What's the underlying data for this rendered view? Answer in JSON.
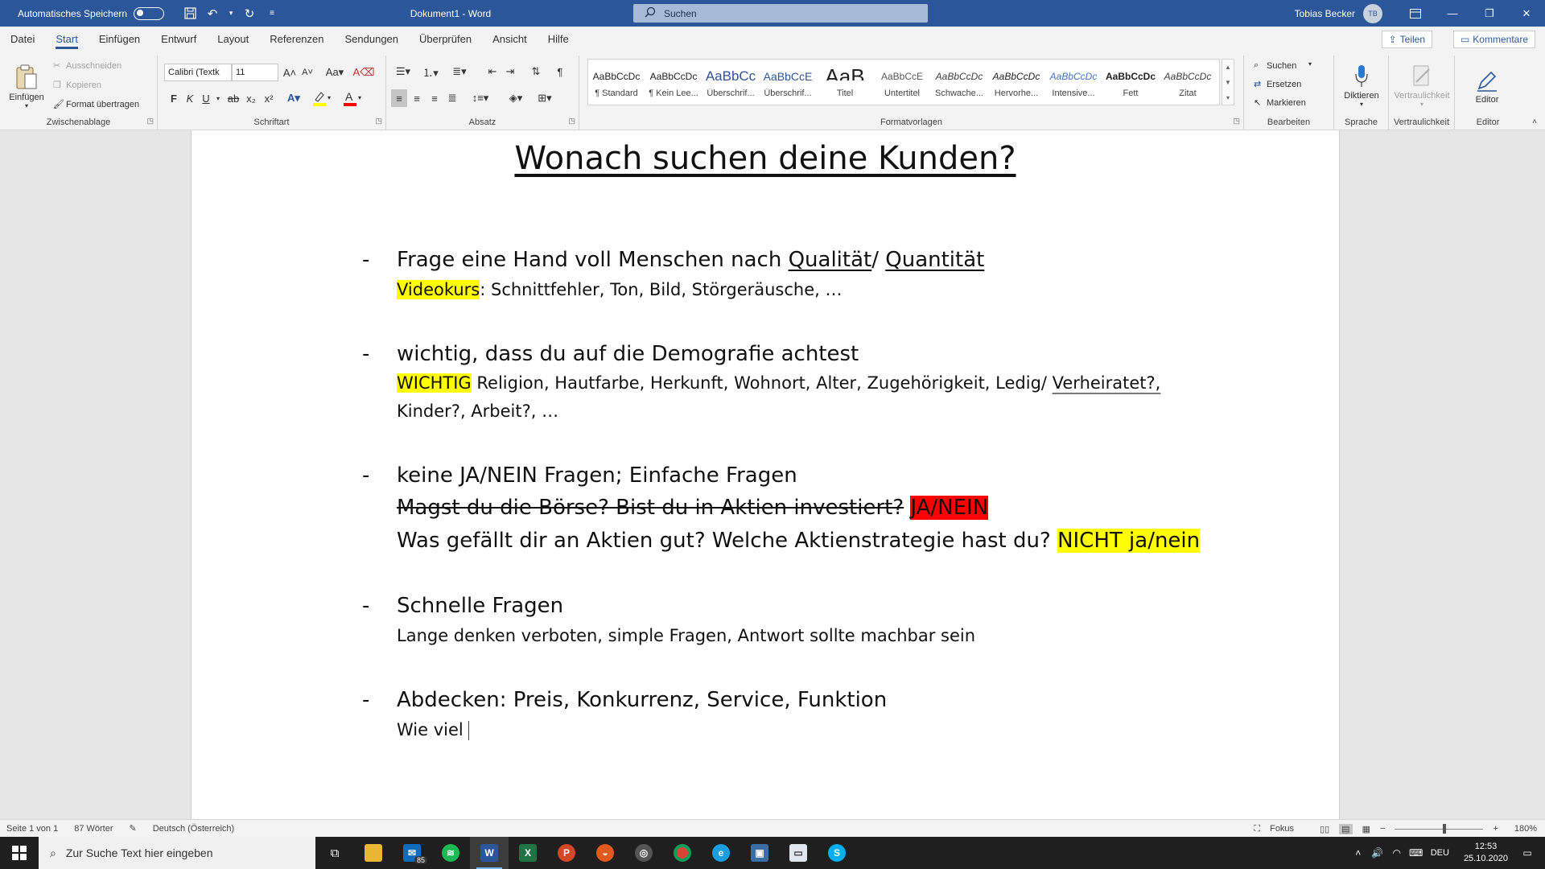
{
  "titlebar": {
    "autosave_label": "Automatisches Speichern",
    "doc_title": "Dokument1  -  Word",
    "search_placeholder": "Suchen",
    "user_name": "Tobias Becker",
    "user_initials": "TB"
  },
  "menu": {
    "tabs": [
      "Datei",
      "Start",
      "Einfügen",
      "Entwurf",
      "Layout",
      "Referenzen",
      "Sendungen",
      "Überprüfen",
      "Ansicht",
      "Hilfe"
    ],
    "active": "Start",
    "share_label": "Teilen",
    "comment_label": "Kommentare"
  },
  "ribbon": {
    "clipboard": {
      "paste_label": "Einfügen",
      "cut_label": "Ausschneiden",
      "copy_label": "Kopieren",
      "format_label": "Format übertragen",
      "group_label": "Zwischenablage"
    },
    "font": {
      "font_name": "Calibri (Textk",
      "font_size": "11",
      "group_label": "Schriftart",
      "bold": "F",
      "italic": "K",
      "underline": "U"
    },
    "paragraph": {
      "group_label": "Absatz"
    },
    "styles": {
      "group_label": "Formatvorlagen",
      "items": [
        {
          "preview": "AaBbCcDc",
          "name": "¶ Standard"
        },
        {
          "preview": "AaBbCcDc",
          "name": "¶ Kein Lee..."
        },
        {
          "preview": "AaBbCc",
          "name": "Überschrif..."
        },
        {
          "preview": "AaBbCcE",
          "name": "Überschrif..."
        },
        {
          "preview": "AaB",
          "name": "Titel"
        },
        {
          "preview": "AaBbCcE",
          "name": "Untertitel"
        },
        {
          "preview": "AaBbCcDc",
          "name": "Schwache..."
        },
        {
          "preview": "AaBbCcDc",
          "name": "Hervorhe..."
        },
        {
          "preview": "AaBbCcDc",
          "name": "Intensive..."
        },
        {
          "preview": "AaBbCcDc",
          "name": "Fett"
        },
        {
          "preview": "AaBbCcDc",
          "name": "Zitat"
        }
      ]
    },
    "editing": {
      "search_label": "Suchen",
      "replace_label": "Ersetzen",
      "select_label": "Markieren",
      "group_label": "Bearbeiten"
    },
    "voice": {
      "dictate_label": "Diktieren",
      "group_label": "Sprache"
    },
    "sensitivity": {
      "label": "Vertraulichkeit",
      "group_label": "Vertraulichkeit"
    },
    "editor": {
      "label": "Editor",
      "group_label": "Editor"
    }
  },
  "document": {
    "heading": "Wonach suchen deine Kunden?",
    "b1": {
      "main_a": "Frage eine Hand voll Menschen nach ",
      "main_u1": "Qualität",
      "main_sep": "/ ",
      "main_u2": "Quantität",
      "sub_hl": "Videokurs",
      "sub_rest": ": Schnittfehler, Ton, Bild, Störgeräusche, …"
    },
    "b2": {
      "main": "wichtig, dass du auf die Demografie achtest",
      "sub_hl": "WICHTIG",
      "sub_rest": " Religion, Hautfarbe, Herkunft, Wohnort, Alter, Zugehörigkeit, Ledig/ ",
      "sub_wavy": "Verheiratet?,",
      "sub2": "Kinder?, Arbeit?, …"
    },
    "b3": {
      "main": "keine JA/NEIN Fragen; Einfache Fragen",
      "strike": "Magst du die Börse? Bist du in Aktien investiert?",
      "red": "JA/NEIN",
      "q": "Was gefällt dir an Aktien gut? Welche Aktienstrategie hast du? ",
      "q_hl": "NICHT ja/nein"
    },
    "b4": {
      "main": "Schnelle Fragen",
      "sub": "Lange denken verboten, simple Fragen, Antwort sollte machbar sein"
    },
    "b5": {
      "main": "Abdecken: Preis, Konkurrenz, Service, Funktion",
      "sub": "Wie viel"
    },
    "bullet_char": "-"
  },
  "statusbar": {
    "page": "Seite 1 von 1",
    "words": "87 Wörter",
    "language": "Deutsch (Österreich)",
    "focus": "Fokus",
    "zoom": "180%"
  },
  "taskbar": {
    "search_placeholder": "Zur Suche Text hier eingeben",
    "mail_badge": "85",
    "lang": "DEU",
    "time": "12:53",
    "date": "25.10.2020"
  }
}
